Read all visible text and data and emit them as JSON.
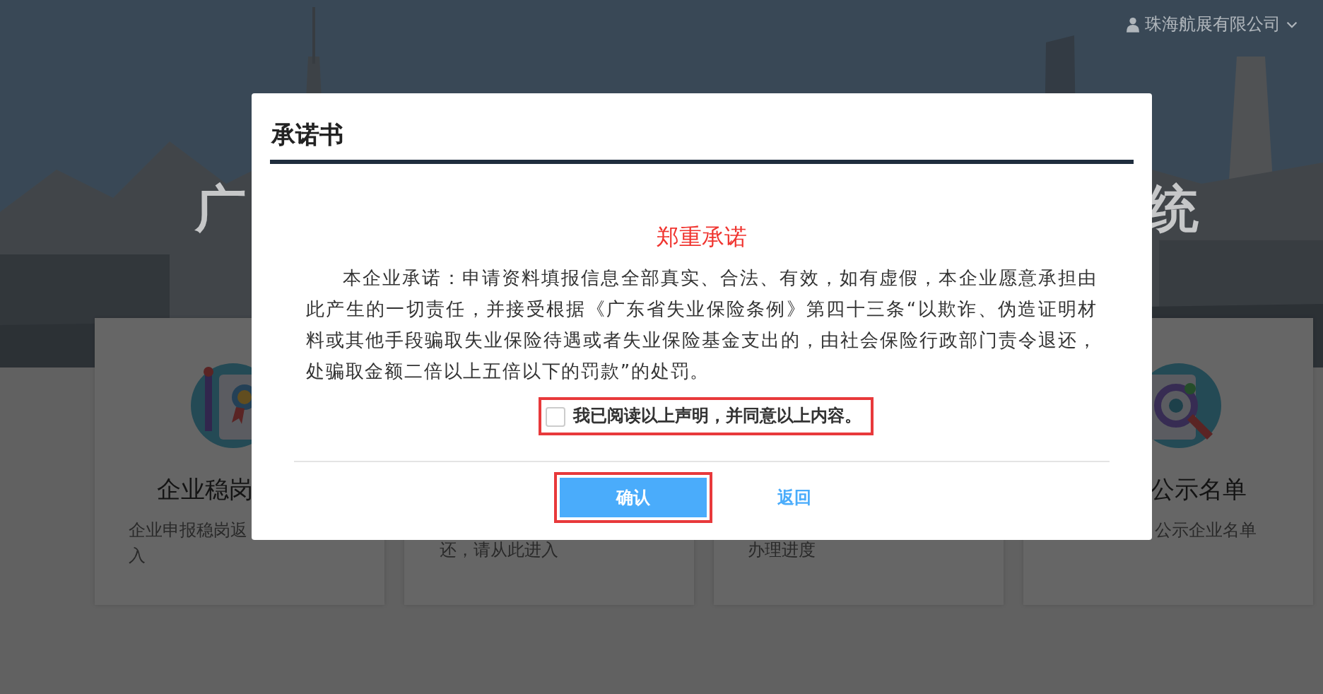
{
  "header": {
    "user": "珠海航展有限公司"
  },
  "hero": {
    "title_parts": [
      "广",
      "统"
    ]
  },
  "cards": [
    {
      "title": "企业稳岗",
      "lines": [
        "企业申报稳岗返",
        "入"
      ]
    },
    {
      "lines": [
        "还，请从此进入"
      ]
    },
    {
      "lines": [
        "办理进度"
      ]
    },
    {
      "title": "公示名单",
      "lines": [
        "公示企业名单"
      ]
    }
  ],
  "dialog": {
    "title": "承诺书",
    "heading": "郑重承诺",
    "body": "本企业承诺：申请资料填报信息全部真实、合法、有效，如有虚假，本企业愿意承担由此产生的一切责任，并接受根据《广东省失业保险条例》第四十三条“以欺诈、伪造证明材料或其他手段骗取失业保险待遇或者失业保险基金支出的，由社会保险行政部门责令退还，处骗取金额二倍以上五倍以下的罚款”的处罚。",
    "agreement": {
      "label": "我已阅读以上声明，并同意以上内容。",
      "checked": false,
      "highlighted": true
    },
    "buttons": [
      {
        "label": "确认",
        "kind": "primary",
        "highlighted": true
      },
      {
        "label": "返回",
        "kind": "link",
        "highlighted": false
      }
    ]
  }
}
